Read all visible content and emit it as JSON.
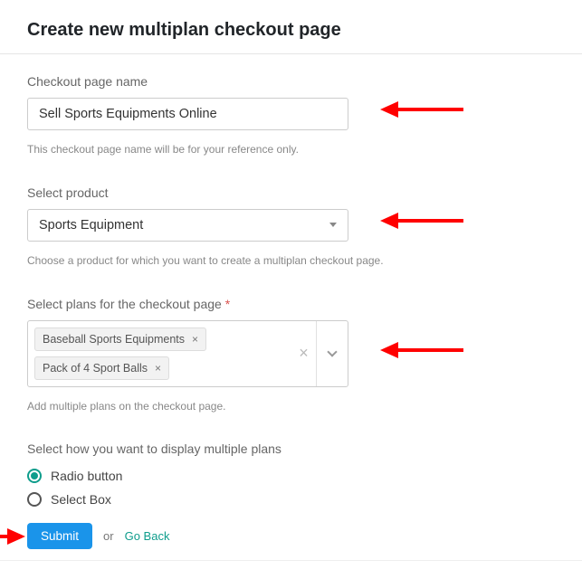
{
  "title": "Create new multiplan checkout page",
  "name_field": {
    "label": "Checkout page name",
    "value": "Sell Sports Equipments Online",
    "hint": "This checkout page name will be for your reference only."
  },
  "product_field": {
    "label": "Select product",
    "value": "Sports Equipment",
    "hint": "Choose a product for which you want to create a multiplan checkout page."
  },
  "plans_field": {
    "label": "Select plans for the checkout page ",
    "required_mark": "*",
    "chips": [
      "Baseball Sports Equipments",
      "Pack of 4 Sport Balls"
    ],
    "hint": "Add multiple plans on the checkout page."
  },
  "display_field": {
    "label": "Select how you want to display multiple plans",
    "options": [
      "Radio button",
      "Select Box"
    ],
    "selected": 0
  },
  "actions": {
    "submit": "Submit",
    "or": "or",
    "go_back": "Go Back"
  }
}
